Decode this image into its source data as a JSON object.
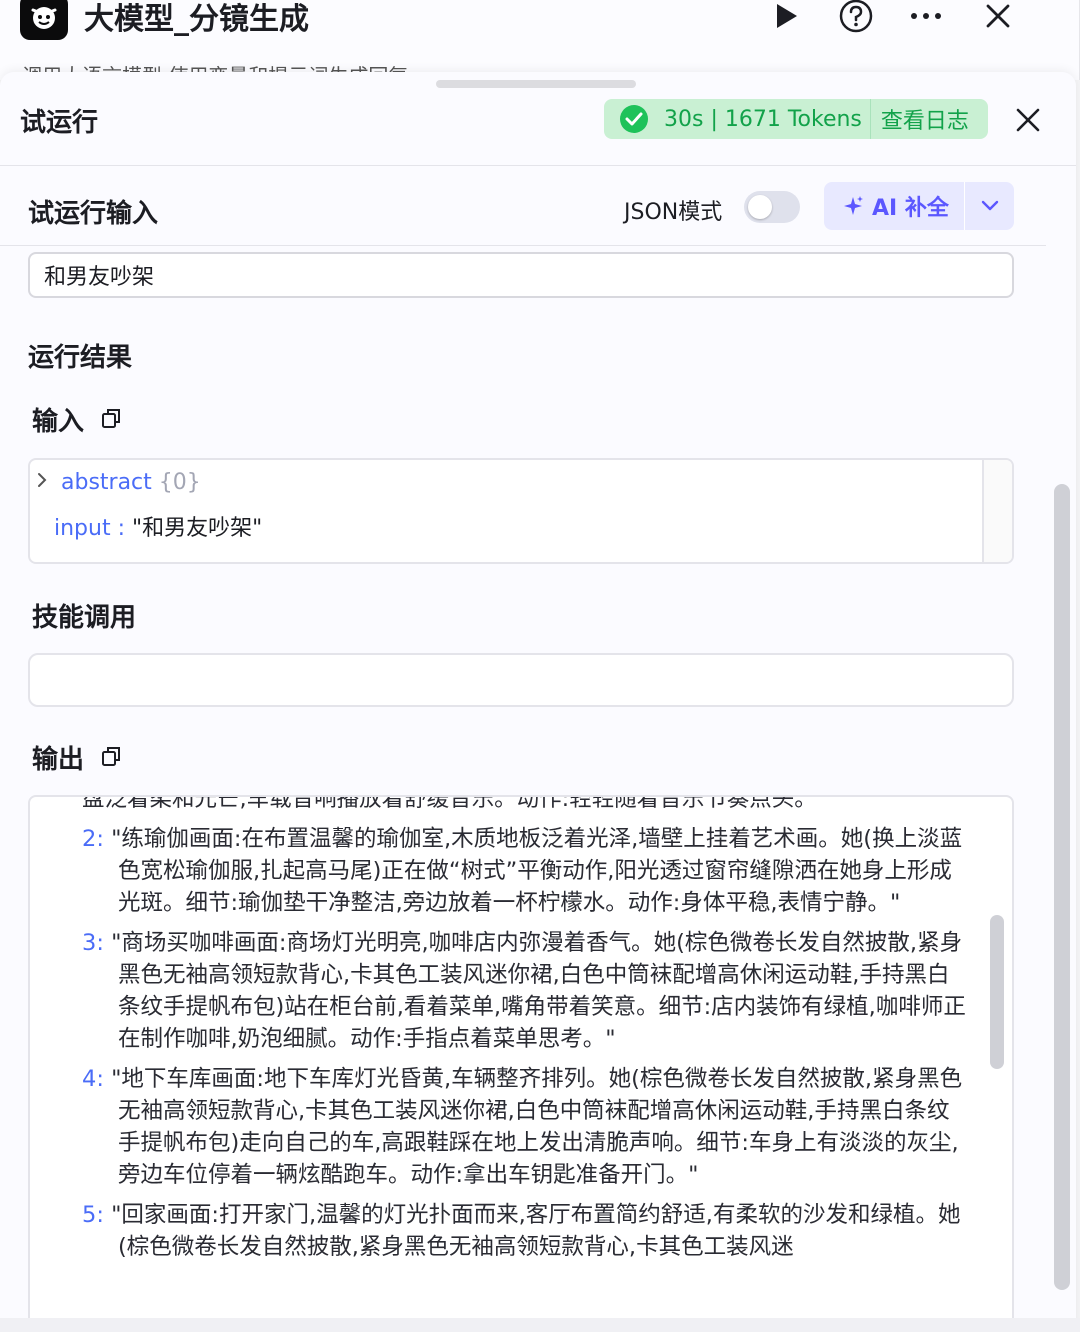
{
  "node": {
    "title": "大模型_分镜生成",
    "description": "调用大语言模型,使用变量和提示词生成回复",
    "icons": [
      "play-icon",
      "help-icon",
      "more-icon",
      "close-icon"
    ]
  },
  "panel": {
    "title": "试运行",
    "status": {
      "duration_tokens": "30s | 1671 Tokens",
      "view_log": "查看日志",
      "color": "#12a24a"
    }
  },
  "input_section": {
    "title": "试运行输入",
    "json_mode_label": "JSON模式",
    "json_mode_on": false,
    "ai_button_label": "AI 补全",
    "input_value": "和男友吵架"
  },
  "results": {
    "title": "运行结果",
    "input_label": "输入",
    "input_json": {
      "abstract_key": "abstract",
      "abstract_meta": "{0}",
      "input_key": "input",
      "input_value": "\"和男友吵架\""
    },
    "skills_label": "技能调用",
    "output_label": "输出",
    "output_partial_top": "盘泛着柔和光芒,车载音响播放着舒缓音乐。动作:轻轻随着音乐节奏点头。\"",
    "output_items": [
      {
        "num": "2",
        "text": "\"练瑜伽画面:在布置温馨的瑜伽室,木质地板泛着光泽,墙壁上挂着艺术画。她(换上淡蓝色宽松瑜伽服,扎起高马尾)正在做“树式”平衡动作,阳光透过窗帘缝隙洒在她身上形成光斑。细节:瑜伽垫干净整洁,旁边放着一杯柠檬水。动作:身体平稳,表情宁静。\""
      },
      {
        "num": "3",
        "text": "\"商场买咖啡画面:商场灯光明亮,咖啡店内弥漫着香气。她(棕色微卷长发自然披散,紧身黑色无袖高领短款背心,卡其色工装风迷你裙,白色中筒袜配增高休闲运动鞋,手持黑白条纹手提帆布包)站在柜台前,看着菜单,嘴角带着笑意。细节:店内装饰有绿植,咖啡师正在制作咖啡,奶泡细腻。动作:手指点着菜单思考。\""
      },
      {
        "num": "4",
        "text": "\"地下车库画面:地下车库灯光昏黄,车辆整齐排列。她(棕色微卷长发自然披散,紧身黑色无袖高领短款背心,卡其色工装风迷你裙,白色中筒袜配增高休闲运动鞋,手持黑白条纹手提帆布包)走向自己的车,高跟鞋踩在地上发出清脆声响。细节:车身上有淡淡的灰尘,旁边车位停着一辆炫酷跑车。动作:拿出车钥匙准备开门。\""
      },
      {
        "num": "5",
        "text": "\"回家画面:打开家门,温馨的灯光扑面而来,客厅布置简约舒适,有柔软的沙发和绿植。她(棕色微卷长发自然披散,紧身黑色无袖高领短款背心,卡其色工装风迷"
      }
    ]
  },
  "colors": {
    "accent": "#4a6cf7",
    "ai_purple": "#5b57ff",
    "success_bg": "#c9f0d3"
  }
}
